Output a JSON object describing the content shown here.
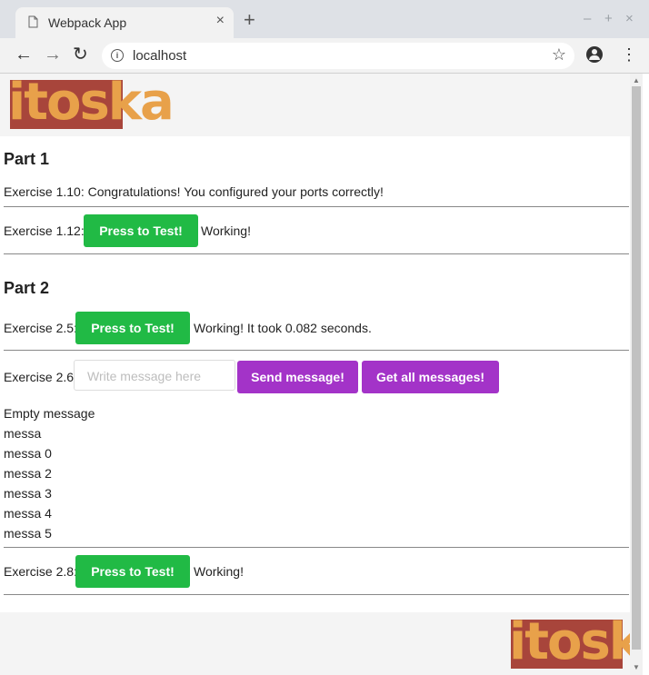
{
  "browser": {
    "tab_title": "Webpack App",
    "tab_close": "×",
    "new_tab": "+",
    "window_controls": {
      "minimize": "–",
      "maximize": "+",
      "close": "×"
    },
    "url": "localhost",
    "nav": {
      "back": "←",
      "forward": "→",
      "reload": "↻",
      "bookmark": "☆",
      "menu": "⋮",
      "info": "i"
    }
  },
  "logo_text": "itoska",
  "part1": {
    "heading": "Part 1",
    "ex110": "Exercise 1.10: Congratulations! You configured your ports correctly!",
    "ex112_label": "Exercise 1.12:",
    "ex112_button": "Press to Test!",
    "ex112_status": "Working!"
  },
  "part2": {
    "heading": "Part 2",
    "ex25_label": "Exercise 2.5:",
    "ex25_button": "Press to Test!",
    "ex25_status": "Working! It took 0.082 seconds.",
    "ex26_label": "Exercise 2.6:",
    "ex26_placeholder": "Write message here",
    "ex26_send": "Send message!",
    "ex26_get": "Get all messages!",
    "messages": [
      "Empty message",
      "messa",
      "messa 0",
      "messa 2",
      "messa 3",
      "messa 4",
      "messa 5"
    ],
    "ex28_label": "Exercise 2.8:",
    "ex28_button": "Press to Test!",
    "ex28_status": "Working!"
  },
  "colors": {
    "green": "#21ba45",
    "purple": "#a333c8",
    "logo_red": "#a8453b",
    "logo_orange": "#e8a14a"
  }
}
